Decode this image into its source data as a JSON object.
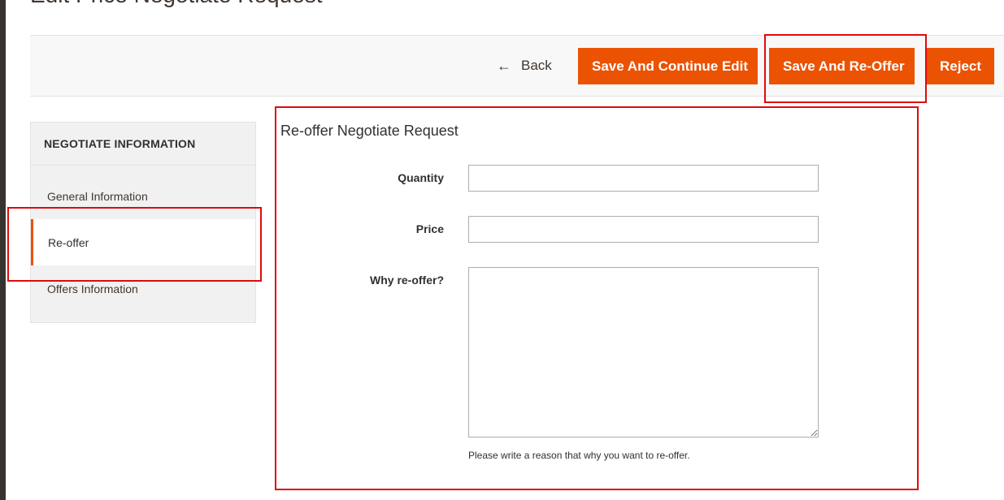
{
  "page": {
    "title": "Edit Price Negotiate Request"
  },
  "actions": {
    "back_label": "Back",
    "back_icon": "arrow-left-icon",
    "save_continue_label": "Save And Continue Edit",
    "save_reoffer_label": "Save And Re-Offer",
    "reject_label": "Reject"
  },
  "sidebar": {
    "title": "NEGOTIATE INFORMATION",
    "items": [
      {
        "label": "General Information",
        "active": false
      },
      {
        "label": "Re-offer",
        "active": true
      },
      {
        "label": "Offers Information",
        "active": false
      }
    ]
  },
  "form": {
    "title": "Re-offer Negotiate Request",
    "quantity_label": "Quantity",
    "quantity_value": "",
    "price_label": "Price",
    "price_value": "",
    "reason_label": "Why re-offer?",
    "reason_value": "",
    "reason_note": "Please write a reason that why you want to re-offer."
  },
  "colors": {
    "accent": "#eb5202",
    "annotation": "#e00a0a",
    "action_bar_bg": "#f8f8f8",
    "sidebar_bg": "#f1f1f1"
  }
}
